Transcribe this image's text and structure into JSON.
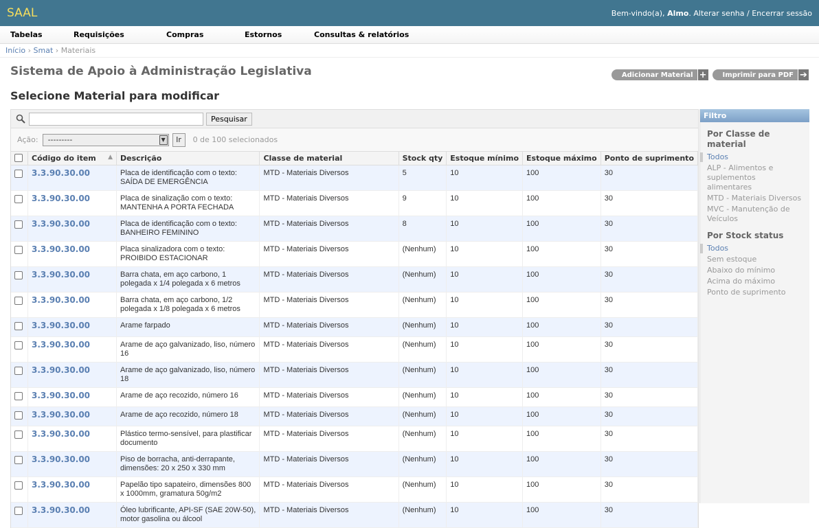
{
  "header": {
    "brand": "SAAL",
    "welcome": "Bem-vindo(a), ",
    "username": "Almo",
    "change_password": "Alterar senha",
    "separator": " / ",
    "logout": "Encerrar sessão"
  },
  "menu": [
    "Tabelas",
    "Requisições",
    "Compras",
    "Estornos",
    "Consultas & relatórios"
  ],
  "breadcrumbs": {
    "home": "Início",
    "app": "Smat",
    "current": "Materiais",
    "sep": " › "
  },
  "site_title": "Sistema de Apoio à Administração Legislativa",
  "page_title": "Selecione Material para modificar",
  "object_tools": {
    "add": "Adicionar Material",
    "print": "Imprimir para PDF"
  },
  "search": {
    "button": "Pesquisar",
    "value": ""
  },
  "actions": {
    "label": "Ação:",
    "selected": "---------",
    "go": "Ir",
    "counter": "0 de 100 selecionados"
  },
  "columns": [
    "Código do item",
    "Descrição",
    "Classe de material",
    "Stock qty",
    "Estoque mínimo",
    "Estoque máximo",
    "Ponto de suprimento"
  ],
  "rows": [
    {
      "code": "3.3.90.30.00",
      "desc": "Placa de identificação com o texto: SAÍDA DE EMERGÊNCIA",
      "cls": "MTD - Materiais Diversos",
      "qty": "5",
      "min": "10",
      "max": "100",
      "sup": "30"
    },
    {
      "code": "3.3.90.30.00",
      "desc": "Placa de sinalização com o texto: MANTENHA A PORTA FECHADA",
      "cls": "MTD - Materiais Diversos",
      "qty": "9",
      "min": "10",
      "max": "100",
      "sup": "30"
    },
    {
      "code": "3.3.90.30.00",
      "desc": "Placa de identificação com o texto: BANHEIRO FEMININO",
      "cls": "MTD - Materiais Diversos",
      "qty": "8",
      "min": "10",
      "max": "100",
      "sup": "30"
    },
    {
      "code": "3.3.90.30.00",
      "desc": "Placa sinalizadora com o texto: PROIBIDO ESTACIONAR",
      "cls": "MTD - Materiais Diversos",
      "qty": "(Nenhum)",
      "min": "10",
      "max": "100",
      "sup": "30"
    },
    {
      "code": "3.3.90.30.00",
      "desc": "Barra chata, em aço carbono, 1 polegada x 1/4 polegada x 6 metros",
      "cls": "MTD - Materiais Diversos",
      "qty": "(Nenhum)",
      "min": "10",
      "max": "100",
      "sup": "30"
    },
    {
      "code": "3.3.90.30.00",
      "desc": "Barra chata, em aço carbono, 1/2 polegada x 1/8 polegada x 6 metros",
      "cls": "MTD - Materiais Diversos",
      "qty": "(Nenhum)",
      "min": "10",
      "max": "100",
      "sup": "30"
    },
    {
      "code": "3.3.90.30.00",
      "desc": "Arame farpado",
      "cls": "MTD - Materiais Diversos",
      "qty": "(Nenhum)",
      "min": "10",
      "max": "100",
      "sup": "30"
    },
    {
      "code": "3.3.90.30.00",
      "desc": "Arame de aço galvanizado, liso, número 16",
      "cls": "MTD - Materiais Diversos",
      "qty": "(Nenhum)",
      "min": "10",
      "max": "100",
      "sup": "30"
    },
    {
      "code": "3.3.90.30.00",
      "desc": "Arame de aço galvanizado, liso, número 18",
      "cls": "MTD - Materiais Diversos",
      "qty": "(Nenhum)",
      "min": "10",
      "max": "100",
      "sup": "30"
    },
    {
      "code": "3.3.90.30.00",
      "desc": "Arame de aço recozido, número 16",
      "cls": "MTD - Materiais Diversos",
      "qty": "(Nenhum)",
      "min": "10",
      "max": "100",
      "sup": "30"
    },
    {
      "code": "3.3.90.30.00",
      "desc": "Arame de aço recozido, número 18",
      "cls": "MTD - Materiais Diversos",
      "qty": "(Nenhum)",
      "min": "10",
      "max": "100",
      "sup": "30"
    },
    {
      "code": "3.3.90.30.00",
      "desc": "Plástico termo-sensível, para plastificar documento",
      "cls": "MTD - Materiais Diversos",
      "qty": "(Nenhum)",
      "min": "10",
      "max": "100",
      "sup": "30"
    },
    {
      "code": "3.3.90.30.00",
      "desc": "Piso de borracha, anti-derrapante, dimensões: 20 x 250 x 330 mm",
      "cls": "MTD - Materiais Diversos",
      "qty": "(Nenhum)",
      "min": "10",
      "max": "100",
      "sup": "30"
    },
    {
      "code": "3.3.90.30.00",
      "desc": "Papelão tipo sapateiro, dimensões 800 x 1000mm, gramatura 50g/m2",
      "cls": "MTD - Materiais Diversos",
      "qty": "(Nenhum)",
      "min": "10",
      "max": "100",
      "sup": "30"
    },
    {
      "code": "3.3.90.30.00",
      "desc": "Óleo lubrificante, API-SF (SAE 20W-50), motor gasolina ou álcool",
      "cls": "MTD - Materiais Diversos",
      "qty": "(Nenhum)",
      "min": "10",
      "max": "100",
      "sup": "30"
    }
  ],
  "filter": {
    "title": "Filtro",
    "groups": [
      {
        "heading": "Por Classe de material",
        "options": [
          "Todos",
          "ALP - Alimentos e suplementos alimentares",
          "MTD - Materiais Diversos",
          "MVC - Manutenção de Veículos"
        ],
        "selected": 0
      },
      {
        "heading": "Por Stock status",
        "options": [
          "Todos",
          "Sem estoque",
          "Abaixo do mínimo",
          "Acima do máximo",
          "Ponto de suprimento"
        ],
        "selected": 0
      }
    ]
  }
}
